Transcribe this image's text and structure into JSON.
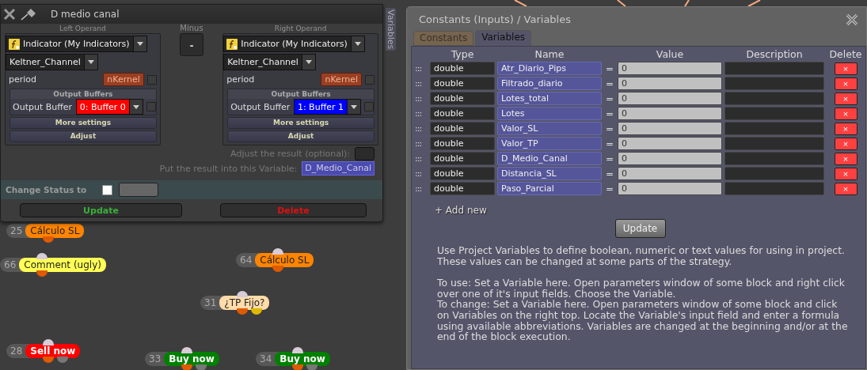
{
  "canvas": {
    "nodes": [
      {
        "number": "25",
        "label": "Cálculo SL",
        "kind": "action",
        "color": "#ff8400"
      },
      {
        "number": "66",
        "label": "Comment (ugly)",
        "kind": "comment",
        "color": "#ffff55"
      },
      {
        "number": "28",
        "label": "Sell now",
        "kind": "trade",
        "color": "#ff0000"
      },
      {
        "number": "64",
        "label": "Cálculo SL",
        "kind": "action",
        "color": "#ff8400"
      },
      {
        "number": "31",
        "label": "¿TP Fijo?",
        "kind": "condition",
        "color": "#ffdcaa"
      },
      {
        "number": "33",
        "label": "Buy now",
        "kind": "trade",
        "color": "#008000"
      },
      {
        "number": "34",
        "label": "Buy now",
        "kind": "trade",
        "color": "#008000"
      }
    ]
  },
  "block_window": {
    "title": "D medio canal",
    "side_tab": "Variables",
    "operands": [
      {
        "heading": "Left Operand",
        "source": "Indicator (My Indicators)",
        "indicator": "Keltner_Channel",
        "param_label": "period",
        "param_value": "nKernel",
        "param_checked": false,
        "buffers_heading": "Output Buffers",
        "buffer_label": "Output Buffer",
        "buffer_value": "0: Buffer 0",
        "buffer_checked": false,
        "more": "More settings",
        "adjust": "Adjust"
      },
      {
        "heading": "Right Operand",
        "source": "Indicator (My Indicators)",
        "indicator": "Keltner_Channel",
        "param_label": "period",
        "param_value": "nKernel",
        "param_checked": false,
        "buffers_heading": "Output Buffers",
        "buffer_label": "Output Buffer",
        "buffer_value": "1: Buffer 1",
        "buffer_checked": false,
        "more": "More settings",
        "adjust": "Adjust"
      }
    ],
    "operator": {
      "heading": "Minus",
      "symbol": "-"
    },
    "adjust_label": "Adjust the result (optional):",
    "result_label": "Put the result into this Variable:",
    "result_value": "D_Medio_Canal",
    "status_label": "Change Status to",
    "status_checked": false,
    "buttons": [
      {
        "label": "Update",
        "kind": "update"
      },
      {
        "label": "Delete",
        "kind": "delete"
      }
    ]
  },
  "variables_window": {
    "title": "Constants (Inputs) / Variables",
    "tabs": [
      {
        "label": "Constants",
        "selected": false
      },
      {
        "label": "Variables",
        "selected": true
      }
    ],
    "columns": [
      "Type",
      "Name",
      "Value",
      "Description",
      "Delete"
    ],
    "rows": [
      {
        "handle": ":::",
        "type": "double",
        "name": "Atr_Diario_Pips",
        "equals": "=",
        "value": "0",
        "delete": "×"
      },
      {
        "handle": ":::",
        "type": "double",
        "name": "Filtrado_diario",
        "equals": "=",
        "value": "0",
        "delete": "×"
      },
      {
        "handle": ":::",
        "type": "double",
        "name": "Lotes_total",
        "equals": "=",
        "value": "0",
        "delete": "×"
      },
      {
        "handle": ":::",
        "type": "double",
        "name": "Lotes",
        "equals": "=",
        "value": "0",
        "delete": "×"
      },
      {
        "handle": ":::",
        "type": "double",
        "name": "Valor_SL",
        "equals": "=",
        "value": "0",
        "delete": "×"
      },
      {
        "handle": ":::",
        "type": "double",
        "name": "Valor_TP",
        "equals": "=",
        "value": "0",
        "delete": "×"
      },
      {
        "handle": ":::",
        "type": "double",
        "name": "D_Medio_Canal",
        "equals": "=",
        "value": "0",
        "delete": "×"
      },
      {
        "handle": ":::",
        "type": "double",
        "name": "Distancia_SL",
        "equals": "=",
        "value": "0",
        "delete": "×"
      },
      {
        "handle": ":::",
        "type": "double",
        "name": "Paso_Parcial",
        "equals": "=",
        "value": "0",
        "delete": "×"
      }
    ],
    "add_new": "+ Add new",
    "update": "Update",
    "help": [
      "Use Project Variables to define boolean, numeric or text values for using in project. These values can be changed at some parts of the strategy.",
      "To use: Set a Variable here. Open parameters window of some block and right click over one of it's input fields. Choose the Variable.",
      "To change: Set a Variable here. Open parameters window of some block and click on Variables on the right top. Locate the Variable's input field and enter a formula using available abbreviations. Variables are changed at the beginning and/or at the end of the block execution."
    ]
  }
}
